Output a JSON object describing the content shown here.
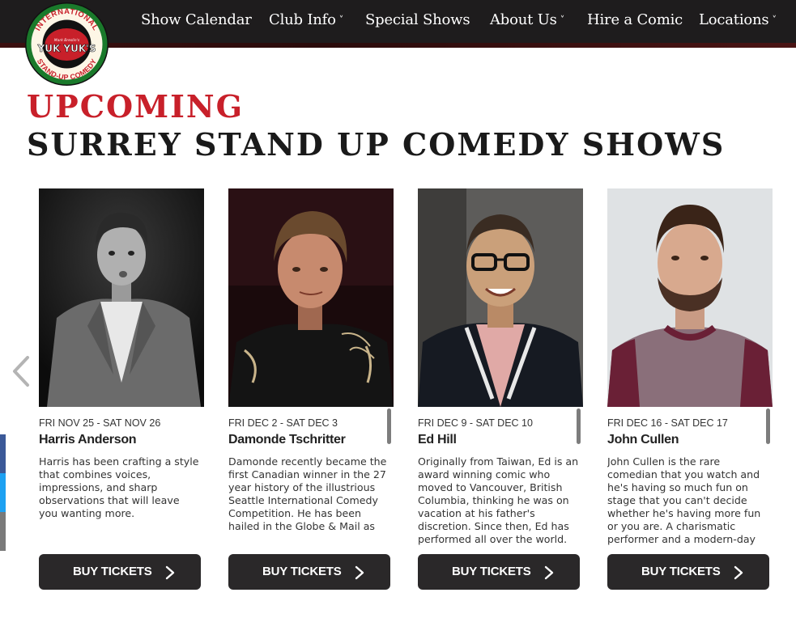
{
  "header": {
    "logo": {
      "icon": "yuk-yuks-logo-icon",
      "text_top": "INTERNATIONAL",
      "text_center": "YUK YUK'S",
      "text_bottom": "STAND-UP COMEDY",
      "text_small": "Mark Breslin's",
      "colors": {
        "ring": "#1a7a2b",
        "accent": "#c8202a"
      }
    },
    "nav": [
      {
        "label": "Show Calendar",
        "has_dropdown": false
      },
      {
        "label": "Club Info",
        "has_dropdown": true
      },
      {
        "label": "Special Shows",
        "has_dropdown": false
      },
      {
        "label": "About Us",
        "has_dropdown": true
      },
      {
        "label": "Hire a Comic",
        "has_dropdown": false
      },
      {
        "label": "Locations",
        "has_dropdown": true
      }
    ],
    "dropdown_glyph": "˅"
  },
  "heading": {
    "upcoming": "UPCOMING",
    "title": "SURREY STAND UP COMEDY SHOWS"
  },
  "carousel": {
    "prev_icon": "chevron-left-icon",
    "shows": [
      {
        "date": "FRI NOV 25 - SAT NOV 26",
        "name": "Harris Anderson",
        "description": "Harris has been crafting a style that combines voices, impressions, and sharp observations that will leave you wanting more.",
        "buy_label": "BUY TICKETS",
        "photo_icon": "comedian-photo-harris-anderson"
      },
      {
        "date": "FRI DEC 2 - SAT DEC 3",
        "name": "Damonde Tschritter",
        "description": "Damonde recently became the first Canadian winner in the 27 year history of the illustrious Seattle International Comedy Competition. He has been hailed in the Globe & Mail as",
        "buy_label": "BUY TICKETS",
        "photo_icon": "comedian-photo-damonde-tschritter"
      },
      {
        "date": "FRI DEC 9 - SAT DEC 10",
        "name": "Ed Hill",
        "description": "Originally from Taiwan, Ed is an award winning comic who moved to Vancouver, British Columbia, thinking he was on vacation at his father's discretion. Since then, Ed has performed all over the world.",
        "buy_label": "BUY TICKETS",
        "photo_icon": "comedian-photo-ed-hill"
      },
      {
        "date": "FRI DEC 16 - SAT DEC 17",
        "name": "John Cullen",
        "description": "John Cullen is the rare comedian that you watch and he's having so much fun on stage that you can't decide whether he's having more fun or you are. A charismatic performer and a modern-day",
        "buy_label": "BUY TICKETS",
        "photo_icon": "comedian-photo-john-cullen"
      }
    ]
  },
  "share_bar": [
    {
      "icon": "facebook-share-icon",
      "color": "#3b5998"
    },
    {
      "icon": "twitter-share-icon",
      "color": "#1da1f2"
    },
    {
      "icon": "email-share-icon",
      "color": "#7a7a7a"
    }
  ]
}
